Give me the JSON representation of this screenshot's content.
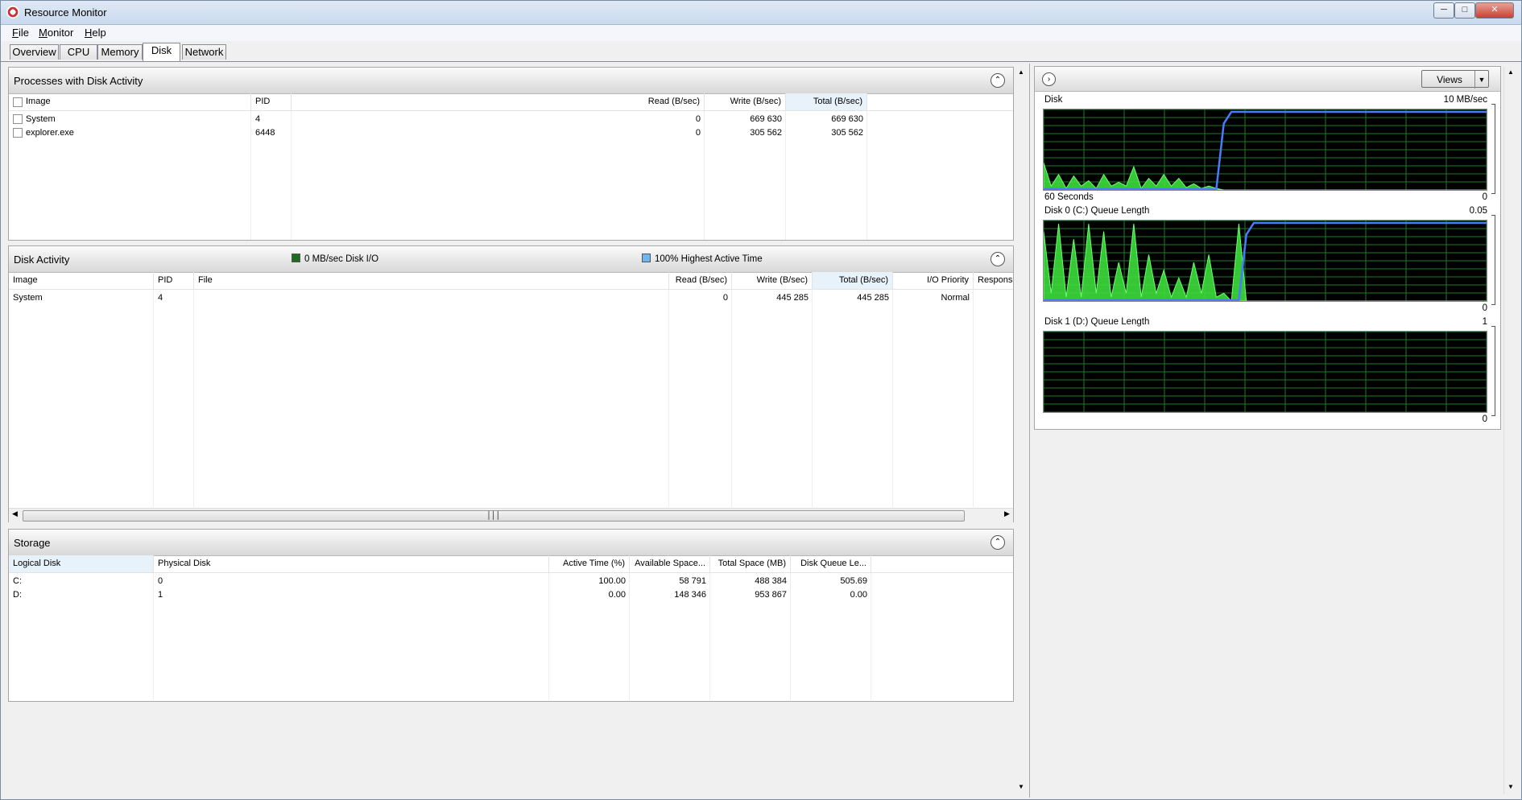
{
  "window": {
    "title": "Resource Monitor"
  },
  "menu": [
    "File",
    "Monitor",
    "Help"
  ],
  "tabs": [
    "Overview",
    "CPU",
    "Memory",
    "Disk",
    "Network"
  ],
  "active_tab": "Disk",
  "processes": {
    "title": "Processes with Disk Activity",
    "columns": [
      "Image",
      "PID",
      "Read (B/sec)",
      "Write (B/sec)",
      "Total (B/sec)"
    ],
    "rows": [
      [
        "System",
        "4",
        "0",
        "669 630",
        "669 630"
      ],
      [
        "explorer.exe",
        "6448",
        "0",
        "305 562",
        "305 562"
      ]
    ]
  },
  "disk_activity": {
    "title": "Disk Activity",
    "legend_io": "0 MB/sec Disk I/O",
    "legend_active": "100% Highest Active Time",
    "colors": {
      "io": "#1f6b1f",
      "active": "#6fb5f2"
    },
    "columns": [
      "Image",
      "PID",
      "File",
      "Read (B/sec)",
      "Write (B/sec)",
      "Total (B/sec)",
      "I/O Priority",
      "Response"
    ],
    "rows": [
      [
        "System",
        "4",
        "",
        "0",
        "445 285",
        "445 285",
        "Normal",
        ""
      ]
    ]
  },
  "storage": {
    "title": "Storage",
    "columns": [
      "Logical Disk",
      "Physical Disk",
      "Active Time (%)",
      "Available Space...",
      "Total Space (MB)",
      "Disk Queue Le..."
    ],
    "rows": [
      [
        "C:",
        "0",
        "100.00",
        "58 791",
        "488 384",
        "505.69"
      ],
      [
        "D:",
        "1",
        "0.00",
        "148 346",
        "953 867",
        "0.00"
      ]
    ]
  },
  "graphs": {
    "views_label": "Views",
    "charts": [
      {
        "title": "Disk",
        "max_label": "10 MB/sec",
        "min_label": "0",
        "time_label": "60 Seconds",
        "green": [
          0.35,
          0.05,
          0.2,
          0.02,
          0.18,
          0.05,
          0.12,
          0.02,
          0.2,
          0.05,
          0.1,
          0.05,
          0.3,
          0.02,
          0.15,
          0.05,
          0.2,
          0.05,
          0.15,
          0.03,
          0.08,
          0.02,
          0.05,
          0.02,
          0.0,
          0.0,
          0.0,
          0.0,
          0.0,
          0.0,
          0.0,
          0.0,
          0.0,
          0.0,
          0.0,
          0.0,
          0.0,
          0.0,
          0.0,
          0.0,
          0.0,
          0.0,
          0.0,
          0.0,
          0.0,
          0.0,
          0.0,
          0.0,
          0.0,
          0.0,
          0.0,
          0.0,
          0.0,
          0.0,
          0.0,
          0.0,
          0.0,
          0.0,
          0.0,
          0.0
        ],
        "blue": [
          0.0,
          0.0,
          0.0,
          0.0,
          0.0,
          0.0,
          0.0,
          0.0,
          0.0,
          0.0,
          0.0,
          0.0,
          0.0,
          0.0,
          0.0,
          0.0,
          0.0,
          0.0,
          0.0,
          0.0,
          0.0,
          0.0,
          0.0,
          0.0,
          0.85,
          1.0,
          1.0,
          1.0,
          1.0,
          1.0,
          1.0,
          1.0,
          1.0,
          1.0,
          1.0,
          1.0,
          1.0,
          1.0,
          1.0,
          1.0,
          1.0,
          1.0,
          1.0,
          1.0,
          1.0,
          1.0,
          1.0,
          1.0,
          1.0,
          1.0,
          1.0,
          1.0,
          1.0,
          1.0,
          1.0,
          1.0,
          1.0,
          1.0,
          1.0,
          1.0
        ]
      },
      {
        "title": "Disk 0 (C:) Queue Length",
        "max_label": "0.05",
        "min_label": "0",
        "green": [
          0.9,
          0.1,
          1.0,
          0.05,
          0.8,
          0.05,
          1.0,
          0.1,
          0.9,
          0.05,
          0.5,
          0.1,
          1.0,
          0.05,
          0.6,
          0.1,
          0.4,
          0.05,
          0.3,
          0.05,
          0.5,
          0.1,
          0.6,
          0.05,
          0.1,
          0.0,
          1.0,
          0.0,
          0.0,
          0.0,
          0.0,
          0.0,
          0.0,
          0.0,
          0.0,
          0.0,
          0.0,
          0.0,
          0.0,
          0.0,
          0.0,
          0.0,
          0.0,
          0.0,
          0.0,
          0.0,
          0.0,
          0.0,
          0.0,
          0.0,
          0.0,
          0.0,
          0.0,
          0.0,
          0.0,
          0.0,
          0.0,
          0.0,
          0.0,
          0.0
        ],
        "blue": [
          0.0,
          0.0,
          0.0,
          0.0,
          0.0,
          0.0,
          0.0,
          0.0,
          0.0,
          0.0,
          0.0,
          0.0,
          0.0,
          0.0,
          0.0,
          0.0,
          0.0,
          0.0,
          0.0,
          0.0,
          0.0,
          0.0,
          0.0,
          0.0,
          0.0,
          0.0,
          0.0,
          0.85,
          1.0,
          1.0,
          1.0,
          1.0,
          1.0,
          1.0,
          1.0,
          1.0,
          1.0,
          1.0,
          1.0,
          1.0,
          1.0,
          1.0,
          1.0,
          1.0,
          1.0,
          1.0,
          1.0,
          1.0,
          1.0,
          1.0,
          1.0,
          1.0,
          1.0,
          1.0,
          1.0,
          1.0,
          1.0,
          1.0,
          1.0,
          1.0
        ]
      },
      {
        "title": "Disk 1 (D:) Queue Length",
        "max_label": "1",
        "min_label": "0",
        "green": [],
        "blue": []
      }
    ]
  }
}
